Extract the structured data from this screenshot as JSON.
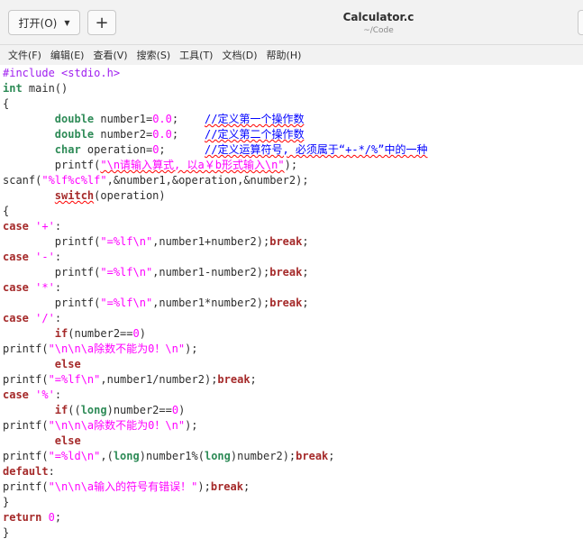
{
  "window": {
    "open_button": "打开(O)",
    "title": "Calculator.c",
    "subtitle": "~/Code"
  },
  "menu": [
    "文件(F)",
    "编辑(E)",
    "查看(V)",
    "搜索(S)",
    "工具(T)",
    "文档(D)",
    "帮助(H)"
  ],
  "code_lines": [
    [
      [
        "pp",
        "#include <stdio.h>"
      ]
    ],
    [
      [
        "ty",
        "int"
      ],
      [
        "",
        " main()"
      ]
    ],
    [
      [
        "",
        "{"
      ]
    ],
    [
      [
        "",
        "        "
      ],
      [
        "ty",
        "double"
      ],
      [
        "",
        " number1="
      ],
      [
        "num",
        "0.0"
      ],
      [
        "",
        ";    "
      ],
      [
        "cm",
        "//定义第一个操作数"
      ]
    ],
    [
      [
        "",
        "        "
      ],
      [
        "ty",
        "double"
      ],
      [
        "",
        " number2="
      ],
      [
        "num",
        "0.0"
      ],
      [
        "",
        ";    "
      ],
      [
        "cm",
        "//定义第二个操作数"
      ]
    ],
    [
      [
        "",
        "        "
      ],
      [
        "ty",
        "char"
      ],
      [
        "",
        " operation="
      ],
      [
        "num",
        "0"
      ],
      [
        "",
        ";      "
      ],
      [
        "cm",
        "//定义运算符号, 必须属于“+-*/%”中的一种"
      ]
    ],
    [
      [
        "",
        "        printf("
      ],
      [
        "str",
        "\"\\n请输入算式, 以a￥b形式输入\\n\""
      ],
      [
        "",
        ");"
      ]
    ],
    [
      [
        "",
        "scanf("
      ],
      [
        "str",
        "\"%lf%c%lf\""
      ],
      [
        "",
        ",&number1,&operation,&number2);"
      ]
    ],
    [
      [
        "",
        "        "
      ],
      [
        "kw",
        "switch"
      ],
      [
        "",
        "(operation)"
      ]
    ],
    [
      [
        "",
        "{"
      ]
    ],
    [
      [
        "kw",
        "case"
      ],
      [
        "",
        " "
      ],
      [
        "str",
        "'+'"
      ],
      [
        "",
        ":"
      ]
    ],
    [
      [
        "",
        "        printf("
      ],
      [
        "str",
        "\"=%lf\\n\""
      ],
      [
        "",
        ",number1+number2);"
      ],
      [
        "kw",
        "break"
      ],
      [
        "",
        ";"
      ]
    ],
    [
      [
        "kw",
        "case"
      ],
      [
        "",
        " "
      ],
      [
        "str",
        "'-'"
      ],
      [
        "",
        ":"
      ]
    ],
    [
      [
        "",
        "        printf("
      ],
      [
        "str",
        "\"=%lf\\n\""
      ],
      [
        "",
        ",number1-number2);"
      ],
      [
        "kw",
        "break"
      ],
      [
        "",
        ";"
      ]
    ],
    [
      [
        "kw",
        "case"
      ],
      [
        "",
        " "
      ],
      [
        "str",
        "'*'"
      ],
      [
        "",
        ":"
      ]
    ],
    [
      [
        "",
        "        printf("
      ],
      [
        "str",
        "\"=%lf\\n\""
      ],
      [
        "",
        ",number1*number2);"
      ],
      [
        "kw",
        "break"
      ],
      [
        "",
        ";"
      ]
    ],
    [
      [
        "kw",
        "case"
      ],
      [
        "",
        " "
      ],
      [
        "str",
        "'/'"
      ],
      [
        "",
        ":"
      ]
    ],
    [
      [
        "",
        "        "
      ],
      [
        "kw",
        "if"
      ],
      [
        "",
        "(number2=="
      ],
      [
        "num",
        "0"
      ],
      [
        "",
        ")"
      ]
    ],
    [
      [
        "",
        "printf("
      ],
      [
        "str",
        "\"\\n\\n\\a除数不能为0！\\n\""
      ],
      [
        "",
        ");"
      ]
    ],
    [
      [
        "",
        "        "
      ],
      [
        "kw",
        "else"
      ]
    ],
    [
      [
        "",
        "printf("
      ],
      [
        "str",
        "\"=%lf\\n\""
      ],
      [
        "",
        ",number1/number2);"
      ],
      [
        "kw",
        "break"
      ],
      [
        "",
        ";"
      ]
    ],
    [
      [
        "kw",
        "case"
      ],
      [
        "",
        " "
      ],
      [
        "str",
        "'%'"
      ],
      [
        "",
        ":"
      ]
    ],
    [
      [
        "",
        "        "
      ],
      [
        "kw",
        "if"
      ],
      [
        "",
        "(("
      ],
      [
        "ty",
        "long"
      ],
      [
        "",
        ")number2=="
      ],
      [
        "num",
        "0"
      ],
      [
        "",
        ")"
      ]
    ],
    [
      [
        "",
        "printf("
      ],
      [
        "str",
        "\"\\n\\n\\a除数不能为0！\\n\""
      ],
      [
        "",
        ");"
      ]
    ],
    [
      [
        "",
        "        "
      ],
      [
        "kw",
        "else"
      ]
    ],
    [
      [
        "",
        "printf("
      ],
      [
        "str",
        "\"=%ld\\n\""
      ],
      [
        "",
        ",("
      ],
      [
        "ty",
        "long"
      ],
      [
        "",
        ")number1%("
      ],
      [
        "ty",
        "long"
      ],
      [
        "",
        ")number2);"
      ],
      [
        "kw",
        "break"
      ],
      [
        "",
        ";"
      ]
    ],
    [
      [
        "kw",
        "default"
      ],
      [
        "",
        ":"
      ]
    ],
    [
      [
        "",
        "printf("
      ],
      [
        "str",
        "\"\\n\\n\\a输入的符号有错误！\""
      ],
      [
        "",
        ");"
      ],
      [
        "kw",
        "break"
      ],
      [
        "",
        ";"
      ]
    ],
    [
      [
        "",
        "}"
      ]
    ],
    [
      [
        "kw",
        "return"
      ],
      [
        "",
        " "
      ],
      [
        "num",
        "0"
      ],
      [
        "",
        ";"
      ]
    ],
    [
      [
        "",
        "}"
      ]
    ]
  ]
}
